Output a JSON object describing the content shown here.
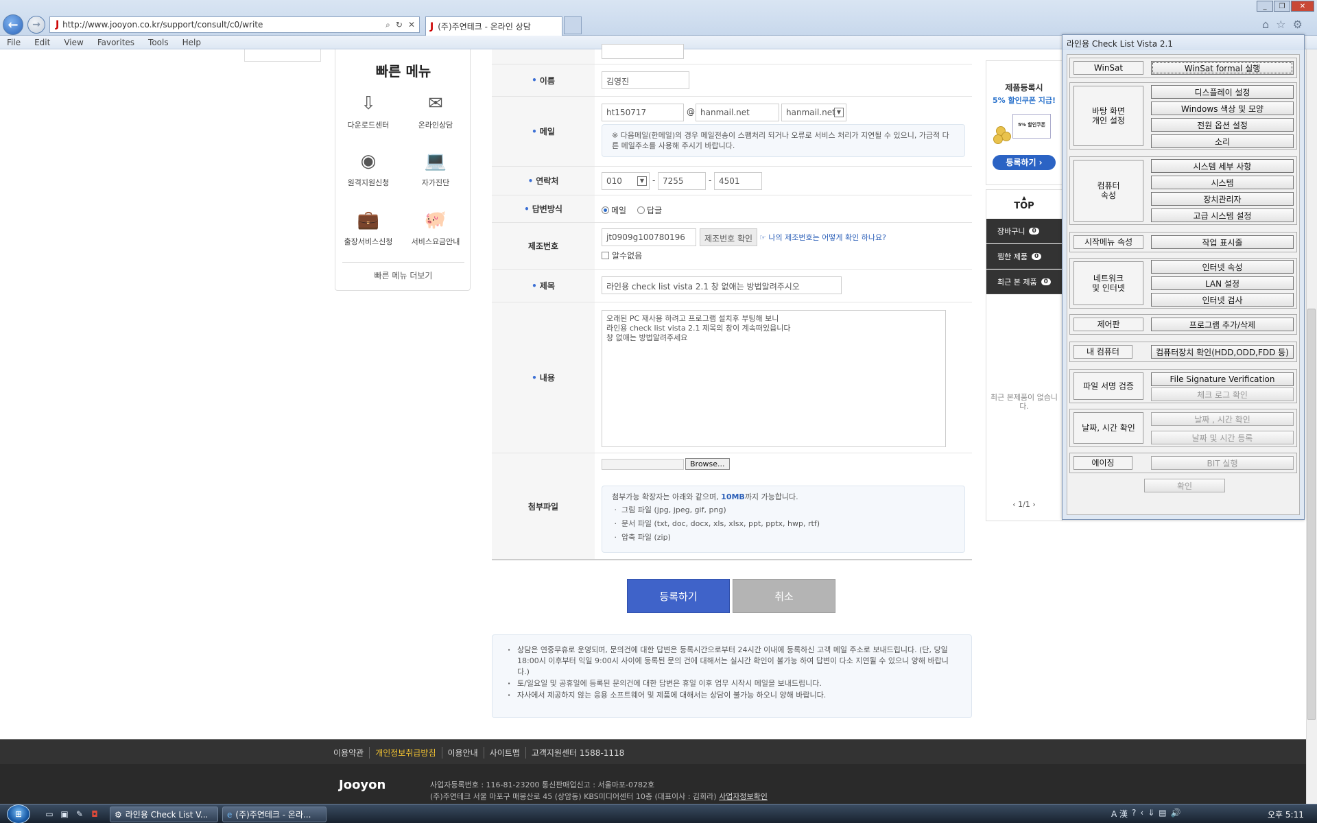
{
  "browser": {
    "url": "http://www.jooyon.co.kr/support/consult/c0/write",
    "tab_title": "(주)주연테크 - 온라인 상담",
    "menu": [
      "File",
      "Edit",
      "View",
      "Favorites",
      "Tools",
      "Help"
    ]
  },
  "quick_menu": {
    "title": "빠른 메뉴",
    "items": [
      "다운로드센터",
      "온라인상담",
      "원격지원신청",
      "자가진단",
      "출장서비스신청",
      "서비스요금안내"
    ],
    "more": "빠른 메뉴 더보기"
  },
  "form": {
    "name_label": "이름",
    "name_value": "김영진",
    "email_label": "메일",
    "email_id": "ht150717",
    "email_at": "@",
    "email_domain": "hanmail.net",
    "email_select": "hanmail.net",
    "email_note": "※ 다음메일(한메일)의 경우 메일전송이 스팸처리 되거나 오류로 서비스 처리가 지연될 수 있으니, 가급적 다른 메일주소를 사용해 주시기 바랍니다.",
    "phone_label": "연락처",
    "phone1": "010",
    "phone2": "7255",
    "phone3": "4501",
    "dash": "-",
    "reply_label": "답변방식",
    "reply_mail": "메일",
    "reply_comment": "답글",
    "serial_label": "제조번호",
    "serial_value": "jt0909g100780196",
    "serial_check": "제조번호 확인",
    "serial_help": "나의 제조번호는 어떻게 확인 하나요?",
    "serial_unknown": "알수없음",
    "subject_label": "제목",
    "subject_value": "라인용 check list vista 2.1 창 없애는 방법알려주시오",
    "content_label": "내용",
    "content_lines": [
      "오래된 PC 재사용 하려고 프로그램 설치후 부팅해 보니",
      "라인용 check list vista 2.1 제목의 창이 계속떠있읍니다",
      "창 없애는 방법알려주세요"
    ],
    "attach_label": "첨부파일",
    "browse": "Browse...",
    "attach_intro_a": "첨부가능 확장자는 아래와 같으며,",
    "attach_limit": "10MB",
    "attach_intro_b": "까지 가능합니다.",
    "attach_types": [
      "그림 파일 (jpg, jpeg, gif, png)",
      "문서 파일 (txt, doc, docx, xls, xlsx, ppt, pptx, hwp, rtf)",
      "압축 파일 (zip)"
    ],
    "submit": "등록하기",
    "cancel": "취소"
  },
  "notice": [
    "상담은 연중무휴로 운영되며, 문의건에 대한 답변은 등록시간으로부터 24시간 이내에 등록하신 고객 메일 주소로 보내드립니다. (단, 당일 18:00시 이후부터 익일 9:00시 사이에 등록된 문의 건에 대해서는 실시간 확인이 불가능 하여 답변이 다소 지연될 수 있으니 양해 바랍니다.)",
    "토/일요일 및 공휴일에 등록된 문의건에 대한 답변은 휴일 이후 업무 시작시 메일을 보내드립니다.",
    "자사에서 제공하지 않는 응용 소프트웨어 및 제품에 대해서는 상담이 불가능 하오니 양해 바랍니다."
  ],
  "promo": {
    "title": "제품등록시",
    "subtitle": "5% 할인쿠폰 지급!",
    "coupon": "5% 할인쿠폰",
    "button": "등록하기 ›"
  },
  "side": {
    "top": "TOP",
    "items": [
      {
        "label": "장바구니",
        "count": "0"
      },
      {
        "label": "찜한 제품",
        "count": "0"
      },
      {
        "label": "최근 본 제품",
        "count": "0"
      }
    ],
    "empty": "최근 본제품이 없습니다.",
    "pager": "1/1"
  },
  "footer": {
    "links": [
      "이용약관",
      "개인정보취급방침",
      "이용안내",
      "사이트맵",
      "고객지원센터 1588-1118"
    ],
    "logo": "Jooyon",
    "info1": "사업자등록번호 : 116-81-23200    통신판매업신고 : 서울마포-0782호",
    "info2": "(주)주연테크 서울 마포구 매봉산로 45 (상암동) KBS미디어센터 10층 (대표이사 : 김희라)",
    "info_link": "사업자정보확인"
  },
  "checklist": {
    "title": "라인용 Check List Vista 2.1",
    "groups": [
      {
        "label": "WinSat",
        "buttons": [
          {
            "text": "WinSat formal 실행",
            "enabled": true
          }
        ]
      },
      {
        "label": "바탕 화면\n개인 설정",
        "buttons": [
          {
            "text": "디스플레이 설정",
            "enabled": true
          },
          {
            "text": "Windows 색상 및 모양",
            "enabled": true
          },
          {
            "text": "전원 옵션 설정",
            "enabled": true
          },
          {
            "text": "소리",
            "enabled": true
          }
        ]
      },
      {
        "label": "컴퓨터\n속성",
        "buttons": [
          {
            "text": "시스템 세부 사항",
            "enabled": true
          },
          {
            "text": "시스템",
            "enabled": true
          },
          {
            "text": "장치관리자",
            "enabled": true
          },
          {
            "text": "고급 시스템 설정",
            "enabled": true
          }
        ]
      },
      {
        "label": "시작메뉴 속성",
        "buttons": [
          {
            "text": "작업 표시줄",
            "enabled": true
          }
        ]
      },
      {
        "label": "네트워크\n및 인터넷",
        "buttons": [
          {
            "text": "인터넷 속성",
            "enabled": true
          },
          {
            "text": "LAN 설정",
            "enabled": true
          },
          {
            "text": "인터넷 검사",
            "enabled": true
          }
        ]
      },
      {
        "label": "제어판",
        "buttons": [
          {
            "text": "프로그램 추가/삭제",
            "enabled": true
          }
        ]
      },
      {
        "label": "내 컴퓨터",
        "buttons": [
          {
            "text": "컴퓨터장치 확인(HDD,ODD,FDD 등)",
            "enabled": true
          }
        ]
      },
      {
        "label": "파일 서명 검증",
        "buttons": [
          {
            "text": "File Signature Verification",
            "enabled": true
          },
          {
            "text": "체크 로그 확인",
            "enabled": false
          }
        ]
      },
      {
        "label": "날짜, 시간 확인",
        "buttons": [
          {
            "text": "날짜 , 시간 확인",
            "enabled": false
          },
          {
            "text": "날짜 및 시간 등록",
            "enabled": false
          }
        ]
      },
      {
        "label": "에이징",
        "buttons": [
          {
            "text": "BIT 실행",
            "enabled": false
          }
        ]
      }
    ],
    "ok": "확인"
  },
  "taskbar": {
    "tasks": [
      "라인용 Check List V...",
      "(주)주연테크 - 온라..."
    ],
    "lang": "A 漢",
    "clock": "오후 5:11"
  },
  "colors": {
    "accent": "#3f63c9",
    "required": "#3b6fd4",
    "highlight": "#f1c232"
  }
}
